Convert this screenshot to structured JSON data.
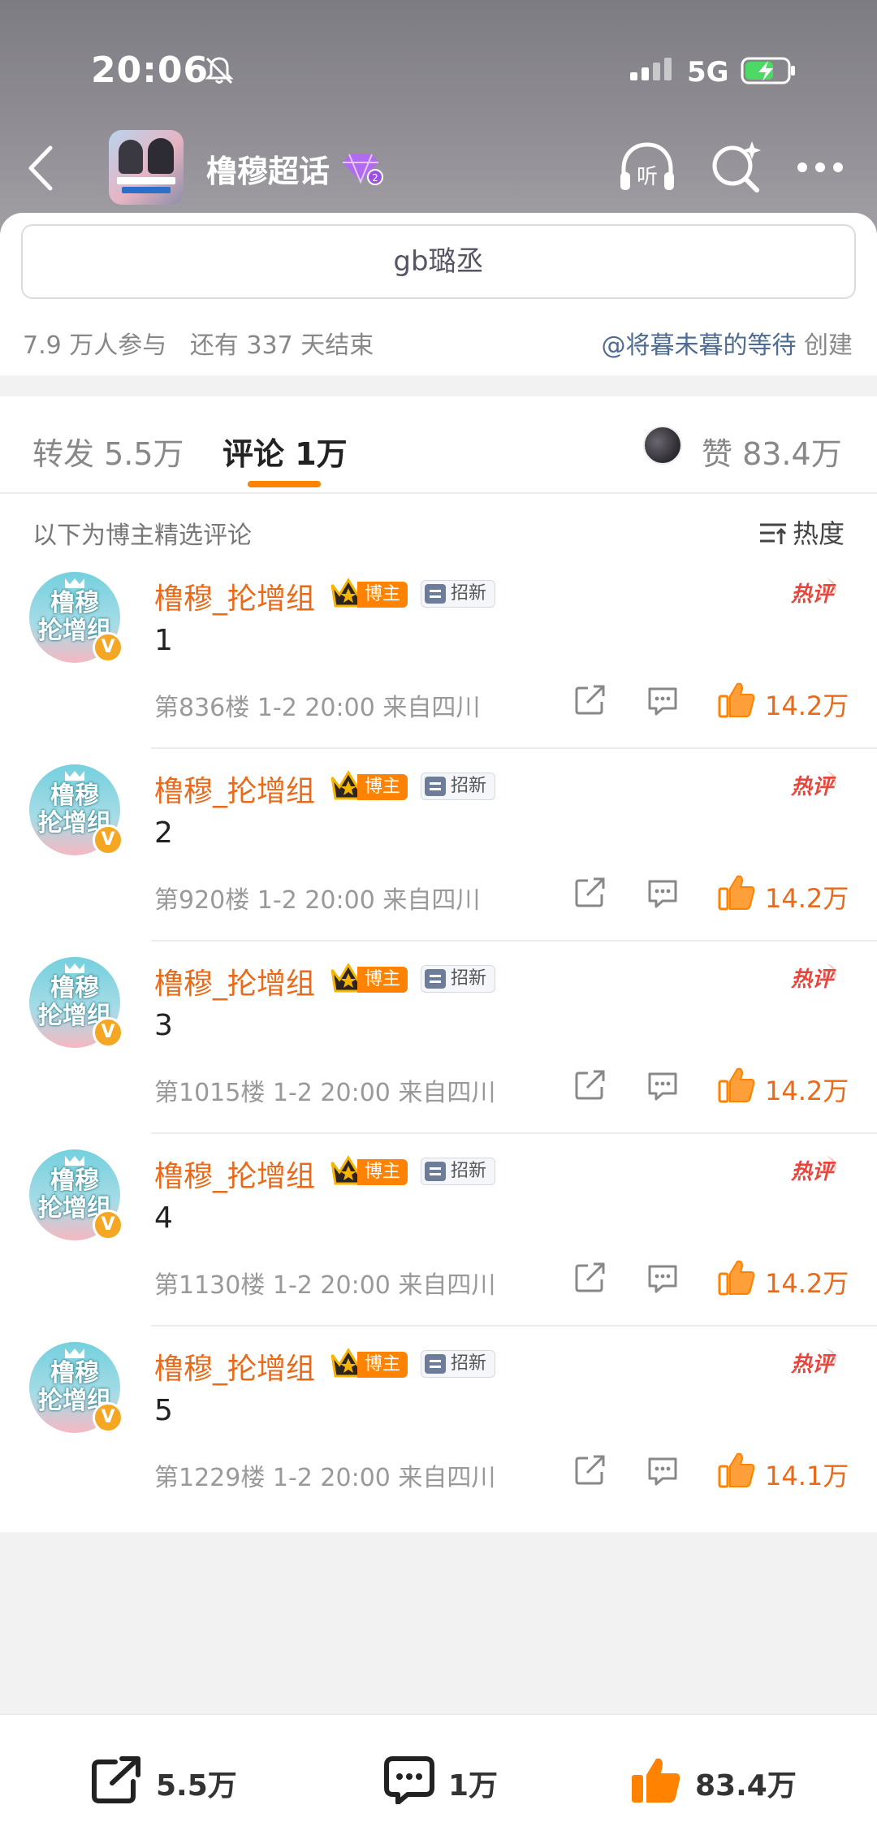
{
  "status_bar": {
    "time": "20:06",
    "network": "5G"
  },
  "header": {
    "group_name": "橹穆超话"
  },
  "topic": {
    "title": "gb璐丞",
    "participants": "7.9 万人参与",
    "remaining": "还有 337 天结束",
    "creator_name": "@将暮未暮的等待",
    "creator_suffix": "创建"
  },
  "tabs": {
    "forward": "转发 5.5万",
    "comments": "评论 1万",
    "likes": "赞 83.4万"
  },
  "selected_note": "以下为博主精选评论",
  "sort_label": "热度",
  "comments": [
    {
      "username": "橹穆_抡增组",
      "avatar_text": "橹穆\n抡增组",
      "badge_owner": "博主",
      "badge_recruit": "招新",
      "text": "1",
      "meta": "第836楼 1-2 20:00 来自四川",
      "likes": "14.2万"
    },
    {
      "username": "橹穆_抡增组",
      "avatar_text": "橹穆\n抡增组",
      "badge_owner": "博主",
      "badge_recruit": "招新",
      "text": "2",
      "meta": "第920楼 1-2 20:00 来自四川",
      "likes": "14.2万"
    },
    {
      "username": "橹穆_抡增组",
      "avatar_text": "橹穆\n抡增组",
      "badge_owner": "博主",
      "badge_recruit": "招新",
      "text": "3",
      "meta": "第1015楼 1-2 20:00 来自四川",
      "likes": "14.2万"
    },
    {
      "username": "橹穆_抡增组",
      "avatar_text": "橹穆\n抡增组",
      "badge_owner": "博主",
      "badge_recruit": "招新",
      "text": "4",
      "meta": "第1130楼 1-2 20:00 来自四川",
      "likes": "14.2万"
    },
    {
      "username": "橹穆_抡增组",
      "avatar_text": "橹穆\n抡增组",
      "badge_owner": "博主",
      "badge_recruit": "招新",
      "text": "5",
      "meta": "第1229楼 1-2 20:00 来自四川",
      "likes": "14.1万"
    }
  ],
  "bottom_bar": {
    "forward": "5.5万",
    "comment": "1万",
    "like": "83.4万"
  },
  "colors": {
    "accent": "#ff8200",
    "username": "#e86a1a",
    "hot": "#e8453c",
    "link": "#4e6b94"
  },
  "icons": [
    "back-icon",
    "mute-bell-icon",
    "signal-icon",
    "battery-charging-icon",
    "gem-level-icon",
    "listen-icon",
    "search-star-icon",
    "more-icon",
    "sort-icon",
    "crown-icon",
    "hot-comment-icon",
    "share-icon",
    "reply-icon",
    "thumbs-up-icon"
  ]
}
